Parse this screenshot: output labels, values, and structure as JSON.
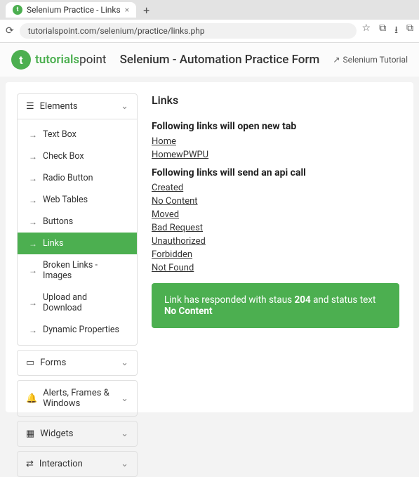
{
  "browser": {
    "tab_title": "Selenium Practice - Links",
    "url": "tutorialspoint.com/selenium/practice/links.php"
  },
  "header": {
    "brand_a": "tutorials",
    "brand_b": "point",
    "title": "Selenium - Automation Practice Form",
    "tutorial_link": "Selenium Tutorial"
  },
  "sidebar": {
    "sections": [
      {
        "icon": "menu-icon",
        "label": "Elements",
        "open": true,
        "items": [
          "Text Box",
          "Check Box",
          "Radio Button",
          "Web Tables",
          "Buttons",
          "Links",
          "Broken Links - Images",
          "Upload and Download",
          "Dynamic Properties"
        ],
        "active_index": 5
      },
      {
        "icon": "form-icon",
        "label": "Forms",
        "open": false
      },
      {
        "icon": "bell-icon",
        "label": "Alerts, Frames & Windows",
        "open": false
      },
      {
        "icon": "widgets-icon",
        "label": "Widgets",
        "open": false
      },
      {
        "icon": "swap-icon",
        "label": "Interaction",
        "open": false
      }
    ]
  },
  "content": {
    "page_title": "Links",
    "newtab_heading": "Following links will open new tab",
    "newtab_links": [
      "Home",
      "HomewPWPU"
    ],
    "api_heading": "Following links will send an api call",
    "api_links": [
      "Created",
      "No Content",
      "Moved",
      "Bad Request",
      "Unauthorized",
      "Forbidden",
      "Not Found"
    ],
    "status": {
      "prefix": "Link has responded with staus ",
      "code": "204",
      "mid": " and status text ",
      "text": "No Content"
    }
  }
}
